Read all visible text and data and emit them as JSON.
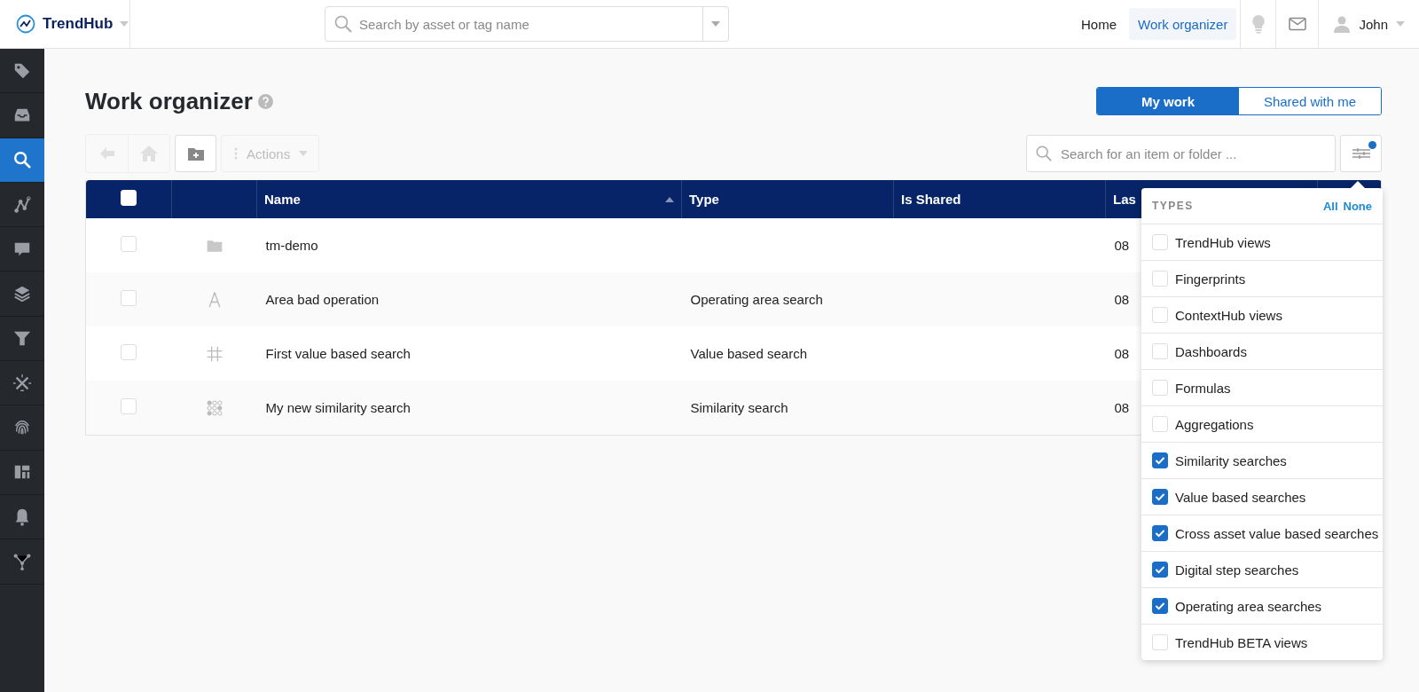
{
  "topbar": {
    "app_name": "TrendHub",
    "search": {
      "placeholder": "Search by asset or tag name"
    },
    "nav": [
      {
        "label": "Home",
        "selected": false
      },
      {
        "label": "Work organizer",
        "selected": true
      }
    ],
    "user": "John"
  },
  "sidebar": {
    "items": [
      {
        "kind": "tag",
        "selected": false
      },
      {
        "kind": "inbox",
        "selected": false
      },
      {
        "kind": "search",
        "selected": true
      },
      {
        "kind": "graph",
        "selected": false
      },
      {
        "kind": "chat",
        "selected": false
      },
      {
        "kind": "layers",
        "selected": false
      },
      {
        "kind": "funnel",
        "selected": false
      },
      {
        "kind": "tools",
        "selected": false
      },
      {
        "kind": "fingerprint",
        "selected": false
      },
      {
        "kind": "dashboard",
        "selected": false
      },
      {
        "kind": "bell",
        "selected": false
      },
      {
        "kind": "network",
        "selected": false
      }
    ]
  },
  "page": {
    "title": "Work organizer",
    "view_toggle": [
      {
        "label": "My work",
        "selected": true
      },
      {
        "label": "Shared with me",
        "selected": false
      }
    ],
    "toolbar": {
      "back_disabled": true,
      "home_disabled": true,
      "actions": {
        "label": "Actions",
        "disabled": true
      }
    },
    "item_search": {
      "placeholder": "Search for an item or folder ..."
    },
    "filter_active": true,
    "table": {
      "header_checked": false,
      "columns": [
        {
          "label": "Name",
          "sorted": true
        },
        {
          "label": "Type"
        },
        {
          "label": "Is Shared"
        },
        {
          "label": "Las"
        }
      ],
      "rows": [
        {
          "kind": "folder",
          "checked": false,
          "name": "tm-demo",
          "column_4": "08"
        },
        {
          "kind": "area",
          "checked": false,
          "name": "Area bad operation",
          "type": "Operating area search",
          "column_4": "08"
        },
        {
          "kind": "value",
          "checked": false,
          "name": "First value based search",
          "type": "Value based search",
          "column_4": "08"
        },
        {
          "kind": "similarity",
          "checked": false,
          "name": "My new similarity search",
          "type": "Similarity search",
          "column_4": "08"
        }
      ]
    },
    "filter_menu": {
      "title": "TYPES",
      "all": "All",
      "none": "None",
      "options": [
        {
          "label": "TrendHub views",
          "checked": false
        },
        {
          "label": "Fingerprints",
          "checked": false
        },
        {
          "label": "ContextHub views",
          "checked": false
        },
        {
          "label": "Dashboards",
          "checked": false
        },
        {
          "label": "Formulas",
          "checked": false
        },
        {
          "label": "Aggregations",
          "checked": false
        },
        {
          "label": "Similarity searches",
          "checked": true
        },
        {
          "label": "Value based searches",
          "checked": true
        },
        {
          "label": "Cross asset value based searches",
          "checked": true
        },
        {
          "label": "Digital step searches",
          "checked": true
        },
        {
          "label": "Operating area searches",
          "checked": true
        },
        {
          "label": "TrendHub BETA views",
          "checked": false
        }
      ]
    }
  }
}
